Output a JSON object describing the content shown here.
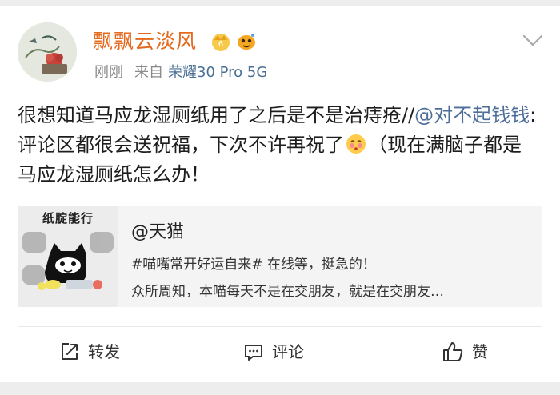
{
  "post": {
    "author": "飘飘云淡风",
    "time": "刚刚",
    "source_prefix": "来自",
    "device": "荣耀30 Pro 5G",
    "text_main": "很想知道马应龙湿厕纸用了之后是不是治痔疮//",
    "mention": "@对不起钱钱",
    "text_after_mention": ":评论区都很会送祝福，下次不许再祝了",
    "text_tail": "（现在满脑子都是马应龙湿厕纸怎么办！"
  },
  "card": {
    "thumb_label": "纸腚能行",
    "title": "@天猫",
    "line1": "#喵嘴常开好运自来# 在线等，挺急的！",
    "line2": "众所周知，本喵每天不是在交朋友，就是在交朋友…"
  },
  "actions": {
    "forward": "转发",
    "comment": "评论",
    "like": "赞"
  },
  "colors": {
    "author": "#e46a1f",
    "link": "#4e6e9a",
    "meta": "#8a8a8a"
  },
  "icons": [
    "vip-badge-icon",
    "fish-badge-icon",
    "chevron-down-icon",
    "share-icon",
    "comment-icon",
    "thumbs-up-icon",
    "blush-emoji-icon"
  ]
}
